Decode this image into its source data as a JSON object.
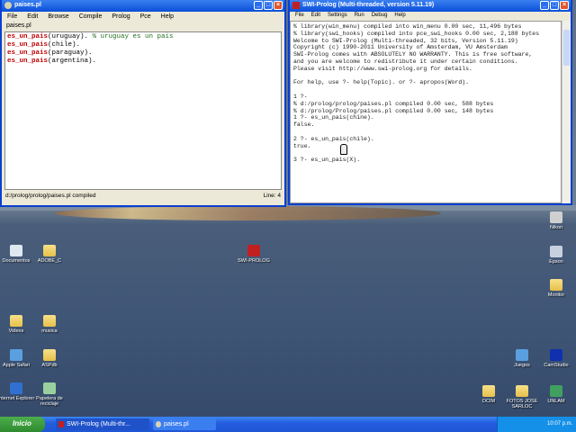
{
  "editor": {
    "title": "paises.pl",
    "menu": [
      "File",
      "Edit",
      "Browse",
      "Compile",
      "Prolog",
      "Pce",
      "Help"
    ],
    "tab": "paises.pl",
    "lines": [
      {
        "pred": "es_un_pais",
        "args": "(uruguay).",
        "comment": " % uruguay es un pais"
      },
      {
        "pred": "es_un_pais",
        "args": "(chile).",
        "comment": ""
      },
      {
        "pred": "es_un_pais",
        "args": "(paraguay).",
        "comment": ""
      },
      {
        "pred": "es_un_pais",
        "args": "(argentina).",
        "comment": ""
      }
    ],
    "status": "d:/prolog/prolog/paises.pl compiled",
    "line": "Line: 4"
  },
  "console": {
    "title": "SWI-Prolog (Multi-threaded, version 5.11.19)",
    "menu": [
      "File",
      "Edit",
      "Settings",
      "Run",
      "Debug",
      "Help"
    ],
    "output": "% library(win_menu) compiled into win_menu 0.00 sec, 11,496 bytes\n% library(swi_hooks) compiled into pce_swi_hooks 0.00 sec, 2,188 bytes\nWelcome to SWI-Prolog (Multi-threaded, 32 bits, Version 5.11.19)\nCopyright (c) 1990-2011 University of Amsterdam, VU Amsterdam\nSWI-Prolog comes with ABSOLUTELY NO WARRANTY. This is free software,\nand you are welcome to redistribute it under certain conditions.\nPlease visit http://www.swi-prolog.org for details.\n\nFor help, use ?- help(Topic). or ?- apropos(Word).\n\n1 ?-\n% d:/prolog/prolog/paises.pl compiled 0.00 sec, 588 bytes\n% d:/prolog/Prolog/paises.pl compiled 0.00 sec, 148 bytes\n1 ?- es_un_pais(chine).\nfalse.\n\n2 ?- es_un_pais(chile).\ntrue.\n\n3 ?- es_un_pais(X)."
  },
  "desktop_icons": [
    "Documentos",
    "ADOBE_C",
    "SWI-PROLOG",
    "Videos",
    "musica",
    "Apple Safari",
    "ASPdb",
    "Internet Explorer",
    "Papelera de reciclaje",
    "Nikon",
    "Epson",
    "Monitor",
    "Juegos",
    "CamStudio",
    "DCIM",
    "FOTOS JOSE SARLOC",
    "UNLAM"
  ],
  "taskbar": {
    "start": "Inicio",
    "tasks": [
      "SWI-Prolog (Multi-thr...",
      "paises.pl"
    ],
    "clock": "10:07 p.m."
  }
}
